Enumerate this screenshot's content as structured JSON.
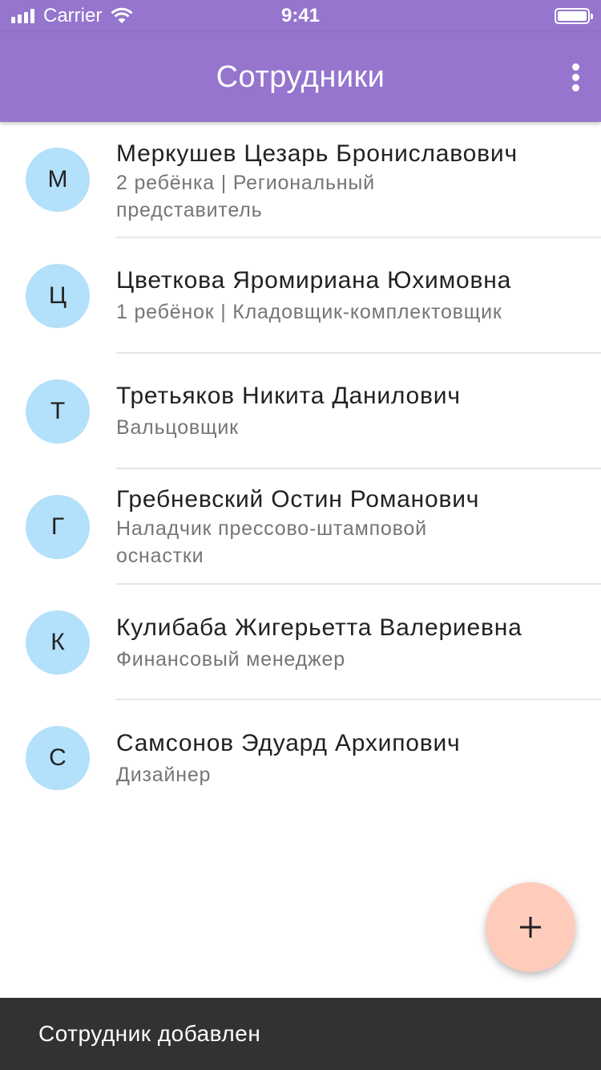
{
  "status_bar": {
    "carrier": "Carrier",
    "time": "9:41",
    "icons": [
      "signal-icon",
      "wifi-icon",
      "battery-icon"
    ]
  },
  "app_bar": {
    "title": "Сотрудники",
    "menu_icon": "more-vert-icon"
  },
  "employees": [
    {
      "initial": "М",
      "name": "Меркушев Цезарь Брониславович",
      "subtitle": "2 ребёнка  |  Региональный представитель"
    },
    {
      "initial": "Ц",
      "name": "Цветкова Яромириана Юхимовна",
      "subtitle": "1 ребёнок  |  Кладовщик-комплектовщик"
    },
    {
      "initial": "Т",
      "name": "Третьяков Никита Данилович",
      "subtitle": "Вальцовщик"
    },
    {
      "initial": "Г",
      "name": "Гребневский Остин Романович",
      "subtitle": "Наладчик прессово-штамповой оснастки"
    },
    {
      "initial": "К",
      "name": "Кулибаба Жигерьетта Валериевна",
      "subtitle": "Финансовый менеджер"
    },
    {
      "initial": "С",
      "name": "Самсонов Эдуард Архипович",
      "subtitle": "Дизайнер"
    }
  ],
  "fab": {
    "icon": "plus-icon"
  },
  "snackbar": {
    "message": "Сотрудник добавлен"
  },
  "colors": {
    "primary": "#9575cd",
    "avatar_bg": "#b3e0fb",
    "fab_bg": "#ffccbc",
    "snackbar_bg": "#323232"
  }
}
